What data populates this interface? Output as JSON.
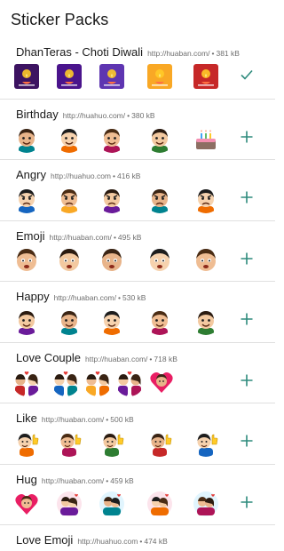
{
  "app_bar": {
    "title": "Sticker Packs"
  },
  "accent_color": "#2e8b7d",
  "packs": [
    {
      "name": "DhanTeras - Choti Diwali",
      "site": "http://huaban.com/",
      "size": "381 kB",
      "action": "added",
      "action_icon": "check-icon"
    },
    {
      "name": "Birthday",
      "site": "http://huahuo.com/",
      "size": "380 kB",
      "action": "add",
      "action_icon": "plus-icon"
    },
    {
      "name": "Angry",
      "site": "http://huahuo.com",
      "size": "416 kB",
      "action": "add",
      "action_icon": "plus-icon"
    },
    {
      "name": "Emoji",
      "site": "http://huaban.com/",
      "size": "495 kB",
      "action": "add",
      "action_icon": "plus-icon"
    },
    {
      "name": "Happy",
      "site": "http://huaban.com/",
      "size": "530 kB",
      "action": "add",
      "action_icon": "plus-icon"
    },
    {
      "name": "Love Couple",
      "site": "http://huaban.com/",
      "size": "718 kB",
      "action": "add",
      "action_icon": "plus-icon"
    },
    {
      "name": "Like",
      "site": "http://huaban.com/",
      "size": "500 kB",
      "action": "add",
      "action_icon": "plus-icon"
    },
    {
      "name": "Hug",
      "site": "http://huaban.com/",
      "size": "459 kB",
      "action": "add",
      "action_icon": "plus-icon"
    },
    {
      "name": "Love Emoji",
      "site": "http://huahuo.com",
      "size": "474 kB",
      "action": "add",
      "action_icon": "plus-icon"
    }
  ],
  "separator": "•"
}
